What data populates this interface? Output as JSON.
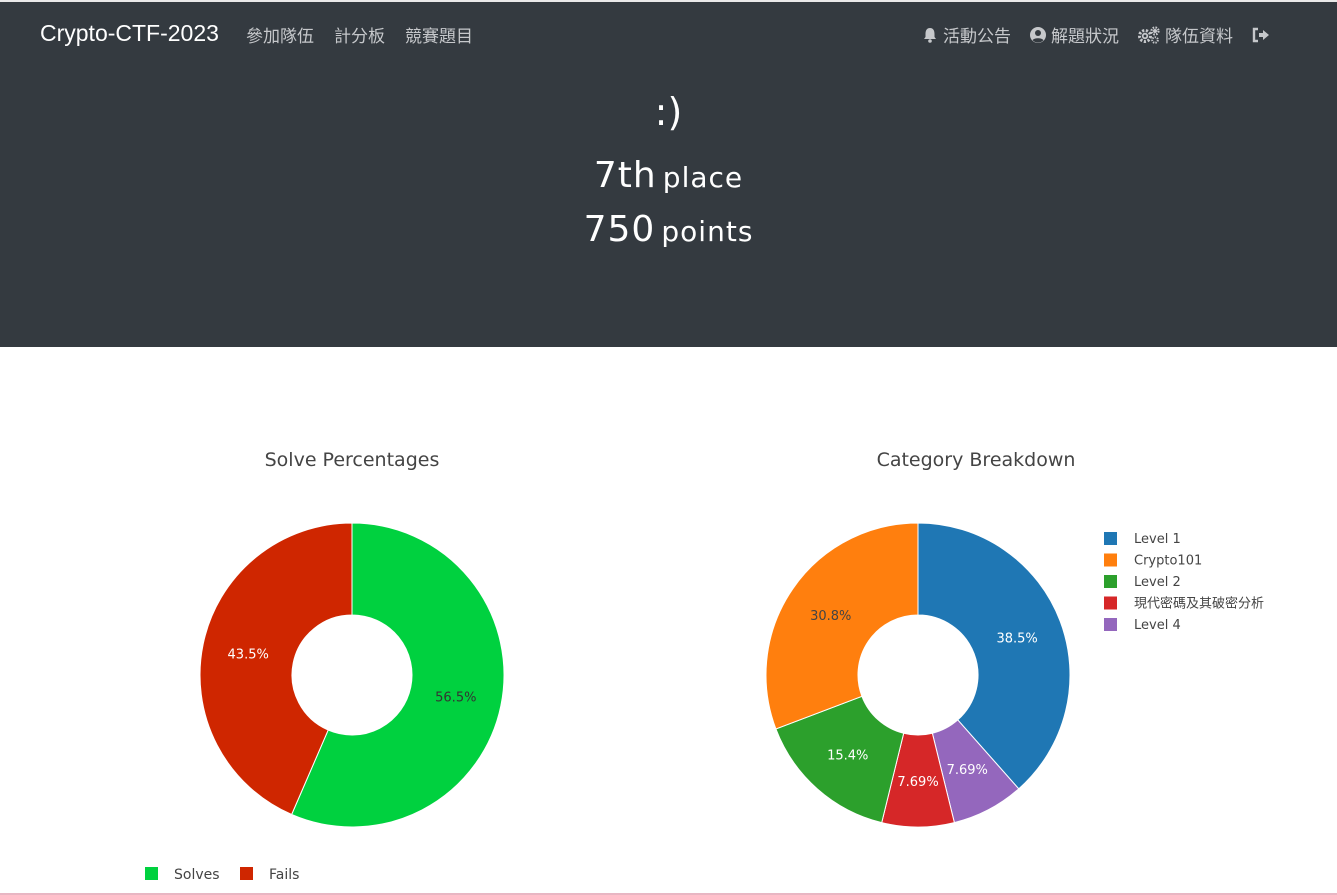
{
  "navbar": {
    "brand": "Crypto-CTF-2023",
    "left_links": [
      "參加隊伍",
      "計分板",
      "競賽題目"
    ],
    "right_links": [
      {
        "label": "活動公告",
        "icon": "bell-icon"
      },
      {
        "label": "解題狀況",
        "icon": "user-circle-icon"
      },
      {
        "label": "隊伍資料",
        "icon": "cogs-icon"
      },
      {
        "label": "",
        "icon": "sign-out-icon"
      }
    ]
  },
  "team": {
    "name": ":)",
    "place_number": "7th",
    "place_label": "place",
    "points_number": "750",
    "points_label": "points"
  },
  "colors": {
    "hero_bg": "#343a40",
    "solves": "#00d13f",
    "fails": "#cf2600",
    "level1": "#1f77b4",
    "crypto101": "#ff7f0e",
    "level2": "#2ca02c",
    "modern": "#d62728",
    "level4": "#9467bd"
  },
  "chart_data": [
    {
      "type": "pie",
      "title": "Solve Percentages",
      "hole": true,
      "legend_position": "bottom",
      "labels": [
        "Solves",
        "Fails"
      ],
      "values": [
        56.5,
        43.5
      ],
      "value_labels": [
        "56.5%",
        "43.5%"
      ],
      "colors": [
        "#00d13f",
        "#cf2600"
      ]
    },
    {
      "type": "pie",
      "title": "Category Breakdown",
      "hole": true,
      "legend_position": "right",
      "labels": [
        "Level 1",
        "Crypto101",
        "Level 2",
        "現代密碼及其破密分析",
        "Level 4"
      ],
      "legend_order": [
        "Level 1",
        "Crypto101",
        "Level 2",
        "現代密碼及其破密分析",
        "Level 4"
      ],
      "slice_order": [
        "Level 1",
        "Level 4",
        "現代密碼及其破密分析",
        "Level 2",
        "Crypto101"
      ],
      "values": {
        "Level 1": 38.5,
        "Crypto101": 30.8,
        "Level 2": 15.4,
        "現代密碼及其破密分析": 7.69,
        "Level 4": 7.69
      },
      "value_labels": {
        "Level 1": "38.5%",
        "Crypto101": "30.8%",
        "Level 2": "15.4%",
        "現代密碼及其破密分析": "7.69%",
        "Level 4": "7.69%"
      },
      "colors": {
        "Level 1": "#1f77b4",
        "Crypto101": "#ff7f0e",
        "Level 2": "#2ca02c",
        "現代密碼及其破密分析": "#d62728",
        "Level 4": "#9467bd"
      }
    }
  ]
}
